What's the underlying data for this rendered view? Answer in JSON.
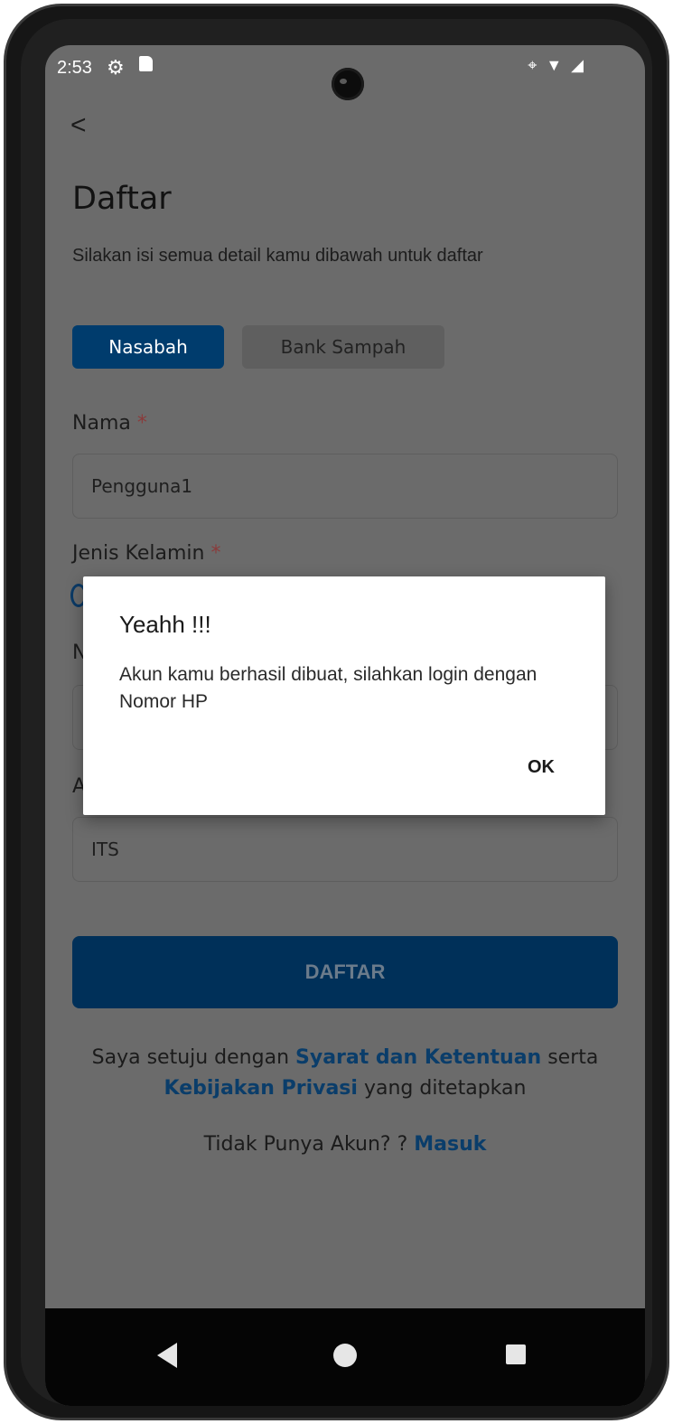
{
  "status_bar": {
    "time": "2:53",
    "settings_icon": "settings-gear-icon",
    "sd_icon": "sd-card-icon",
    "location_icon": "location-pin-icon",
    "wifi_icon": "wifi-icon",
    "signal_icon": "signal-icon"
  },
  "header": {
    "back_icon": "<",
    "title": "Daftar",
    "subtitle": "Silakan isi semua detail kamu dibawah untuk daftar"
  },
  "tabs": [
    {
      "label": "Nasabah",
      "active": true
    },
    {
      "label": "Bank Sampah",
      "active": false
    }
  ],
  "form": {
    "name_label": "Nama",
    "name_value": "Pengguna1",
    "gender_label": "Jenis Kelamin",
    "required_mark": "*",
    "row3_label_peek": "N",
    "row4_label_peek": "A",
    "address_value": "ITS"
  },
  "submit_label": "DAFTAR",
  "terms": {
    "prefix": "Saya setuju dengan ",
    "link1": "Syarat dan Ketentuan",
    "middle": " serta ",
    "link2": "Kebijakan Privasi",
    "suffix": " yang ditetapkan"
  },
  "login": {
    "prompt": "Tidak Punya Akun? ? ",
    "link": "Masuk"
  },
  "dialog": {
    "title": "Yeahh !!!",
    "message": "Akun kamu berhasil dibuat, silahkan login dengan Nomor HP",
    "ok_label": "OK"
  },
  "colors": {
    "primary": "#003c6d",
    "overlay_background": "#6b6b6b",
    "link": "#0a3d6a",
    "required": "#8a3b3b"
  }
}
